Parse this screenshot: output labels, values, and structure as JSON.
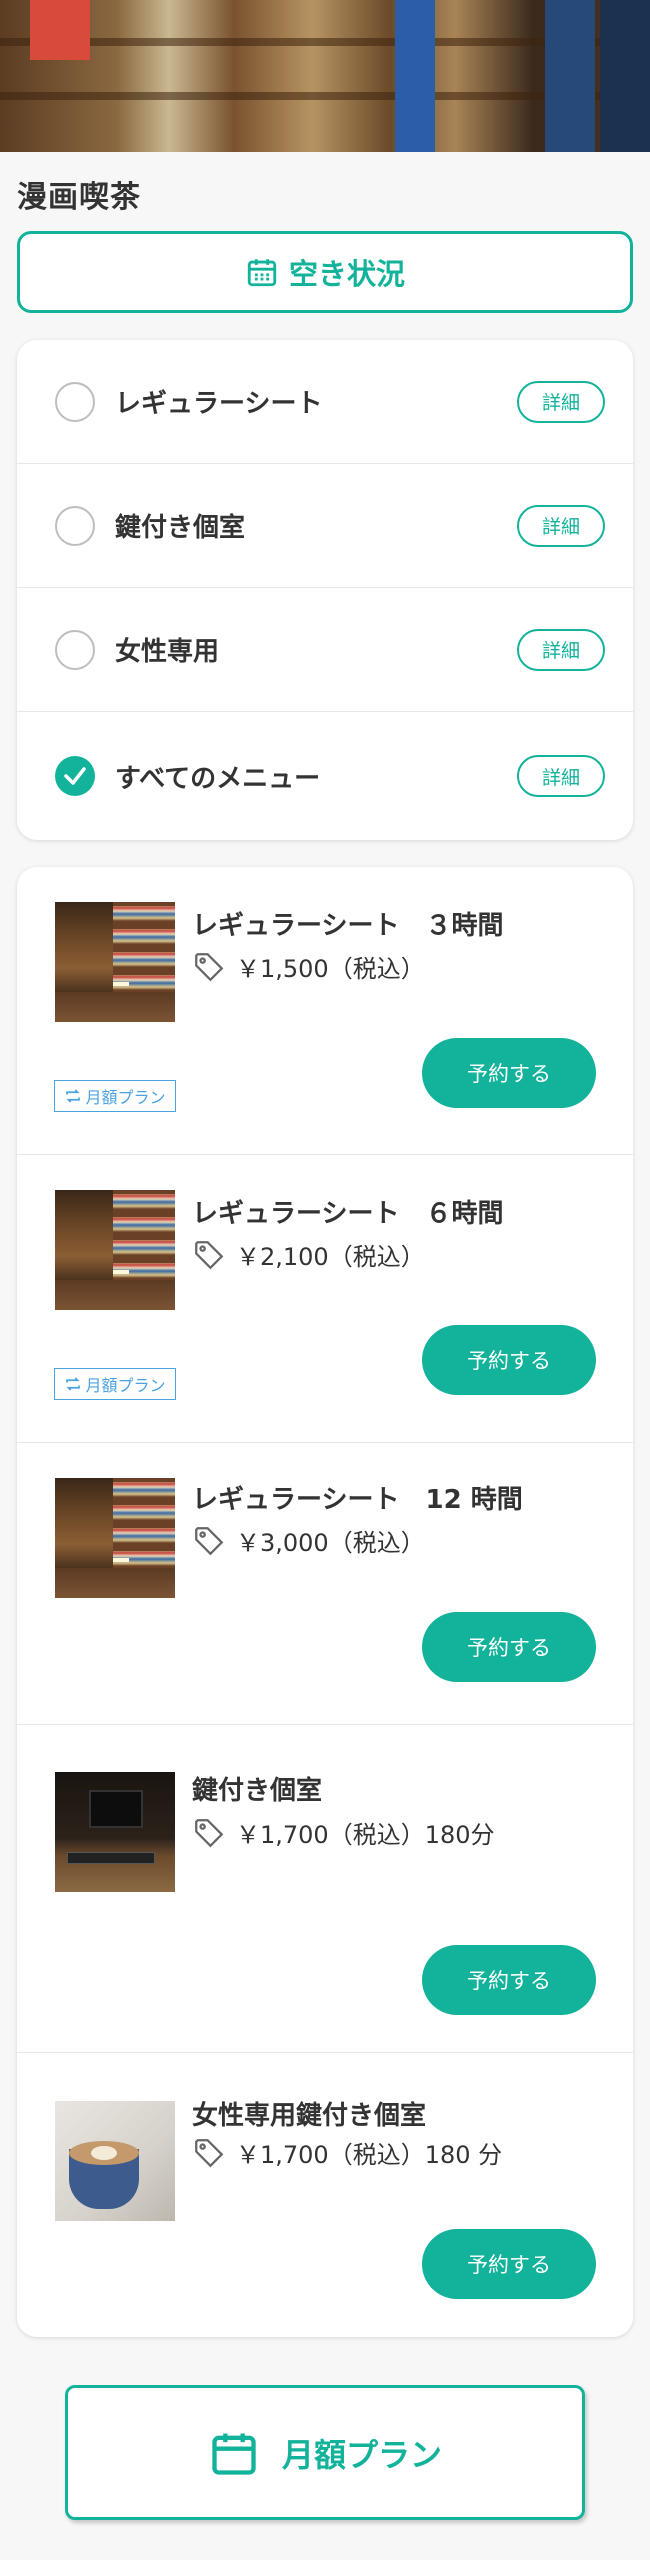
{
  "shop": {
    "name": "漫画喫茶"
  },
  "availability": {
    "label": "空き状況",
    "icon": "calendar-icon"
  },
  "filters": [
    {
      "label": "レギュラーシート",
      "selected": false,
      "detail_label": "詳細"
    },
    {
      "label": "鍵付き個室",
      "selected": false,
      "detail_label": "詳細"
    },
    {
      "label": "女性専用",
      "selected": false,
      "detail_label": "詳細"
    },
    {
      "label": "すべてのメニュー",
      "selected": true,
      "detail_label": "詳細"
    }
  ],
  "menu": [
    {
      "title": "レギュラーシート　３時間",
      "price": "￥1,500（税込）",
      "button": "予約する",
      "monthly_tag": "月額プラン",
      "image": "bookshelf-photo"
    },
    {
      "title": "レギュラーシート　６時間",
      "price": "￥2,100（税込）",
      "button": "予約する",
      "monthly_tag": "月額プラン",
      "image": "bookshelf-photo"
    },
    {
      "title": "レギュラーシート　12 時間",
      "price": "￥3,000（税込）",
      "button": "予約する",
      "monthly_tag": "",
      "image": "bookshelf-photo"
    },
    {
      "title": "鍵付き個室",
      "price": "￥1,700（税込）180分",
      "button": "予約する",
      "monthly_tag": "",
      "image": "desk-photo"
    },
    {
      "title": "女性専用鍵付き個室",
      "price": "￥1,700（税込）180 分",
      "button": "予約する",
      "monthly_tag": "",
      "image": "coffee-photo"
    }
  ],
  "monthly_plan": {
    "label": "月額プラン",
    "icon": "calendar-icon"
  },
  "colors": {
    "accent": "#12b39a",
    "tag_blue": "#4aa3df"
  }
}
